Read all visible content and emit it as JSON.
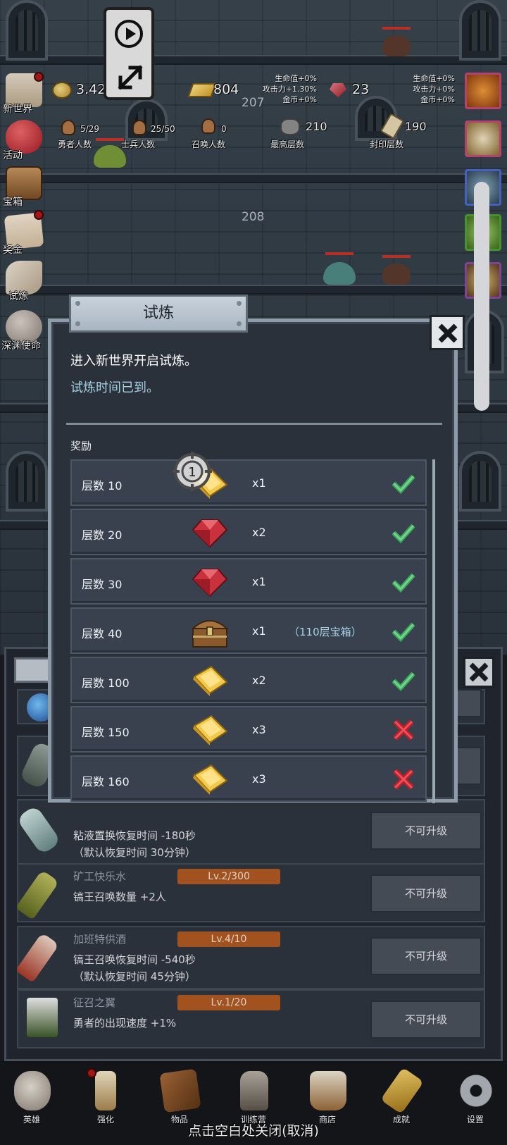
{
  "hud": {
    "coin_value": "3.42E+21",
    "gold_value": "804",
    "gem_value": "23",
    "stats_left": [
      "生命值+0%",
      "攻击力+1.30%",
      "金币+0%"
    ],
    "stats_right": [
      "生命值+0%",
      "攻击力+0%",
      "金币+0%"
    ],
    "counters": [
      {
        "value": "5/29",
        "label": "勇者人数"
      },
      {
        "value": "25/50",
        "label": "士兵人数"
      },
      {
        "value": "0",
        "label": "召唤人数"
      },
      {
        "value": "210",
        "label": "最高层数"
      },
      {
        "value": "190",
        "label": "封印层数"
      }
    ],
    "floor_a": "207",
    "floor_b": "208"
  },
  "side_menu": [
    "新世界",
    "活动",
    "宝箱",
    "奖金",
    "试炼",
    "深渊使命"
  ],
  "modal": {
    "title": "试炼",
    "intro": "进入新世界开启试炼。",
    "status_text": "试炼时间已到。",
    "reward_label": "奖励",
    "marker_number": "1",
    "rewards": [
      {
        "floor": "层数 10",
        "item": "gold-bar",
        "qty": "x1",
        "note": "",
        "claimed": true
      },
      {
        "floor": "层数 20",
        "item": "ruby",
        "qty": "x2",
        "note": "",
        "claimed": true
      },
      {
        "floor": "层数 30",
        "item": "ruby",
        "qty": "x1",
        "note": "",
        "claimed": true
      },
      {
        "floor": "层数 40",
        "item": "treasure-chest",
        "qty": "x1",
        "note": "（110层宝箱）",
        "claimed": true
      },
      {
        "floor": "层数 100",
        "item": "gold-bar",
        "qty": "x2",
        "note": "",
        "claimed": true
      },
      {
        "floor": "层数 150",
        "item": "gold-bar",
        "qty": "x3",
        "note": "",
        "claimed": false
      },
      {
        "floor": "层数 160",
        "item": "gold-bar",
        "qty": "x3",
        "note": "",
        "claimed": false
      }
    ]
  },
  "upgrades": [
    {
      "name": "",
      "level": "",
      "desc": "粘液置换恢复时间 -180秒\n（默认恢复时间 30分钟）",
      "button": "不可升级"
    },
    {
      "name": "矿工快乐水",
      "level": "Lv.2/300",
      "desc": "镐王召唤数量 +2人",
      "button": "不可升级"
    },
    {
      "name": "加班特供酒",
      "level": "Lv.4/10",
      "desc": "镐王召唤恢复时间 -540秒\n（默认恢复时间 45分钟）",
      "button": "不可升级"
    },
    {
      "name": "征召之翼",
      "level": "Lv.1/20",
      "desc": "勇者的出现速度 +1%",
      "button": "不可升级"
    }
  ],
  "bottom_nav": [
    "英雄",
    "强化",
    "物品",
    "训练营",
    "商店",
    "成就",
    "设置"
  ],
  "close_hint": "点击空白处关闭(取消)",
  "colors": {
    "panel": "#2a313b",
    "row": "#38414d",
    "accent_text": "#a6d3e6",
    "check": "#4cb86a",
    "cross": "#d8333a",
    "level_badge": "#b05a22"
  }
}
